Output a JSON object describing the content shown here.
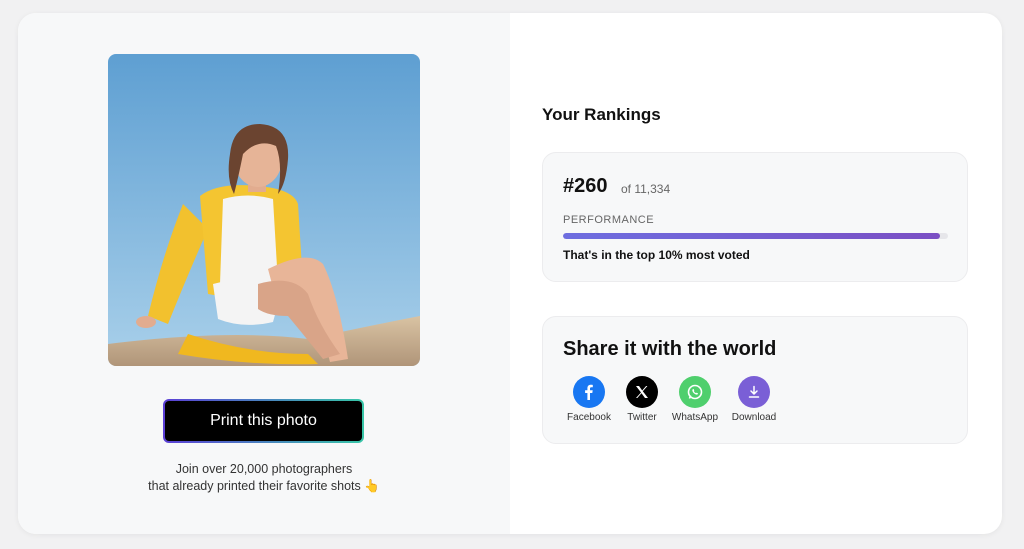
{
  "left": {
    "print_button_label": "Print this photo",
    "join_line1": "Join over 20,000 photographers",
    "join_line2": "that already printed their favorite shots",
    "join_emoji": "👆"
  },
  "rankings": {
    "title": "Your Rankings",
    "rank": "#260",
    "of_total": "of 11,334",
    "performance_label": "PERFORMANCE",
    "performance_fraction": 0.98,
    "top_text": "That's in the top 10% most voted"
  },
  "share": {
    "title": "Share it with the world",
    "items": [
      {
        "label": "Facebook",
        "icon": "facebook-icon",
        "color": "#1877f2"
      },
      {
        "label": "Twitter",
        "icon": "x-icon",
        "color": "#000000"
      },
      {
        "label": "WhatsApp",
        "icon": "whatsapp-icon",
        "color": "#4fcf6d"
      },
      {
        "label": "Download",
        "icon": "download-icon",
        "color": "#7a5fd6"
      }
    ]
  }
}
